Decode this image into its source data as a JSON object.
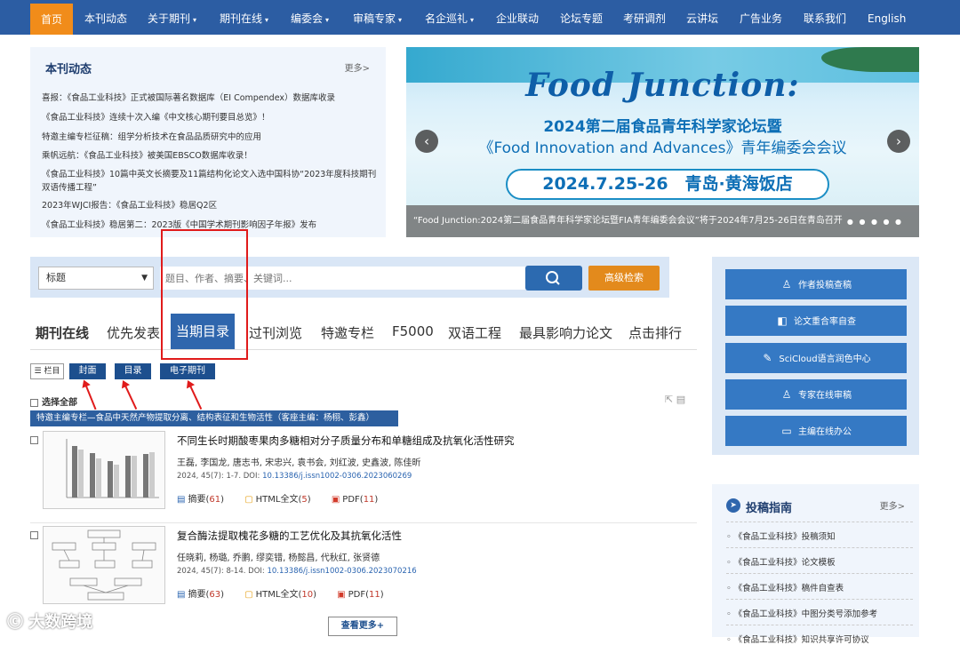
{
  "nav": {
    "items": [
      "首页",
      "本刊动态",
      "关于期刊",
      "期刊在线",
      "编委会",
      "审稿专家",
      "名企巡礼",
      "企业联动",
      "论坛专题",
      "考研调剂",
      "云讲坛",
      "广告业务",
      "联系我们",
      "English"
    ]
  },
  "news": {
    "title": "本刊动态",
    "more": "更多>",
    "items": [
      "喜报：《食品工业科技》正式被国际著名数据库（EI Compendex）数据库收录",
      "《食品工业科技》连续十次入编《中文核心期刊要目总览》！",
      "特邀主编专栏征稿：组学分析技术在食品品质研究中的应用",
      "乘帆远航：《食品工业科技》被美国EBSCO数据库收录！",
      "《食品工业科技》10篇中英文长摘要及11篇结构化论文入选中国科协“2023年度科技期刊双语传播工程”",
      "2023年WJCI报告：《食品工业科技》稳居Q2区",
      "《食品工业科技》稳居第二：2023版《中国学术期刊影响因子年报》发布"
    ]
  },
  "banner": {
    "title": "Food Junction:",
    "line1": "2024第二届食品青年科学家论坛暨",
    "line2": "《Food Innovation and Advances》青年编委会会议",
    "date_place": "2024.7.25-26　青岛·黄海饭店",
    "caption": "“Food Junction:2024第二届食品青年科学家论坛暨FIA青年编委会会议”将于2024年7月25-26日在青岛召开",
    "prev": "‹",
    "next": "›"
  },
  "search": {
    "field": "标题",
    "placeholder": "题目、作者、摘要、关键词...",
    "advanced": "高级检索"
  },
  "tabs": [
    "期刊在线",
    "优先发表",
    "当期目录",
    "过刊浏览",
    "特邀专栏",
    "F5000",
    "双语工程",
    "最具影响力论文",
    "点击排行"
  ],
  "toolbar": {
    "columns": "栏目",
    "cover": "封面",
    "toc": "目录",
    "ejournal": "电子期刊",
    "select_all": "选择全部"
  },
  "column_title": "特邀主编专栏—食品中天然产物提取分离、结构表征和生物活性（客座主编：杨栩、彭鑫）",
  "articles": [
    {
      "title": "不同生长时期酸枣果肉多糖相对分子质量分布和单糖组成及抗氧化活性研究",
      "authors": "王磊, 李国龙, 唐志书, 宋忠兴, 袁书会, 刘红波, 史鑫波, 陈佳昕",
      "year": "2024, 45(7): 1-7.",
      "doi_label": "DOI:",
      "doi": "10.13386/j.issn1002-0306.2023060269",
      "abstract_label": "摘要",
      "abstract_count": "61",
      "html_label": "HTML全文",
      "html_count": "5",
      "pdf_label": "PDF",
      "pdf_count": "11"
    },
    {
      "title": "复合酶法提取槐花多糖的工艺优化及其抗氧化活性",
      "authors": "任晓莉, 杨璐, 乔鹏, 缪奕错, 杨懿昌, 代秋红, 张贤德",
      "year": "2024, 45(7): 8-14.",
      "doi_label": "DOI:",
      "doi": "10.13386/j.issn1002-0306.2023070216",
      "abstract_label": "摘要",
      "abstract_count": "63",
      "html_label": "HTML全文",
      "html_count": "10",
      "pdf_label": "PDF",
      "pdf_count": "11"
    }
  ],
  "more_button": "查看更多+",
  "side": {
    "buttons": [
      "作者投稿查稿",
      "论文重合率自查",
      "SciCloud语言润色中心",
      "专家在线审稿",
      "主编在线办公"
    ]
  },
  "guide": {
    "title": "投稿指南",
    "more": "更多>",
    "items": [
      "《食品工业科技》投稿须知",
      "《食品工业科技》论文模板",
      "《食品工业科技》稿件自查表",
      "《食品工业科技》中图分类号添加参考",
      "《食品工业科技》知识共享许可协议"
    ]
  },
  "watermark": "大数跨境"
}
